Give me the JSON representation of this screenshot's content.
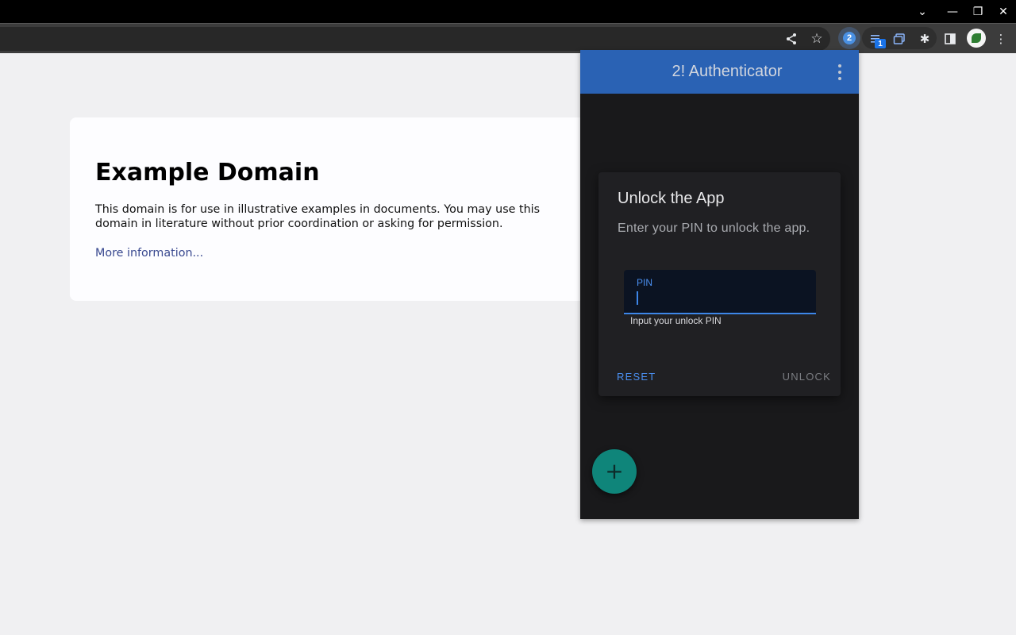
{
  "browser": {
    "window_controls": {
      "tab_search_glyph": "⌄",
      "minimize_glyph": "—",
      "restore_glyph": "❐",
      "close_glyph": "✕"
    },
    "toolbar": {
      "share_glyph": "⋖",
      "bookmark_glyph": "☆",
      "authenticator_ext_glyph": "2",
      "reading_list_badge": "1",
      "puzzle_glyph": "✱",
      "side_panel_glyph": "▮",
      "menu_glyph": "⋮"
    }
  },
  "page": {
    "title": "Example Domain",
    "text": "This domain is for use in illustrative examples in documents. You may use this domain in literature without prior coordination or asking for permission.",
    "link": "More information..."
  },
  "popup": {
    "title": "2! Authenticator",
    "dialog": {
      "title": "Unlock the App",
      "description": "Enter your PIN to unlock the app.",
      "pin_label": "PIN",
      "pin_value": "",
      "pin_hint": "Input your unlock PIN",
      "reset_label": "RESET",
      "unlock_label": "UNLOCK"
    },
    "fab_glyph": "+"
  },
  "colors": {
    "header": "#2a62b4",
    "accent": "#4a8ff0",
    "fab": "#0f857a",
    "popup_bg": "#19191b",
    "page_bg": "#f0f0f2"
  },
  "icons": {
    "share": "share-icon",
    "bookmark": "star-icon",
    "authenticator": "authenticator-extension-icon",
    "reading_list": "reading-list-icon",
    "tab_capture": "tab-capture-icon",
    "extensions": "puzzle-icon",
    "side_panel": "side-panel-icon",
    "profile": "profile-avatar",
    "chrome_menu": "kebab-menu-icon",
    "popup_menu": "kebab-menu-icon",
    "add": "plus-icon"
  }
}
